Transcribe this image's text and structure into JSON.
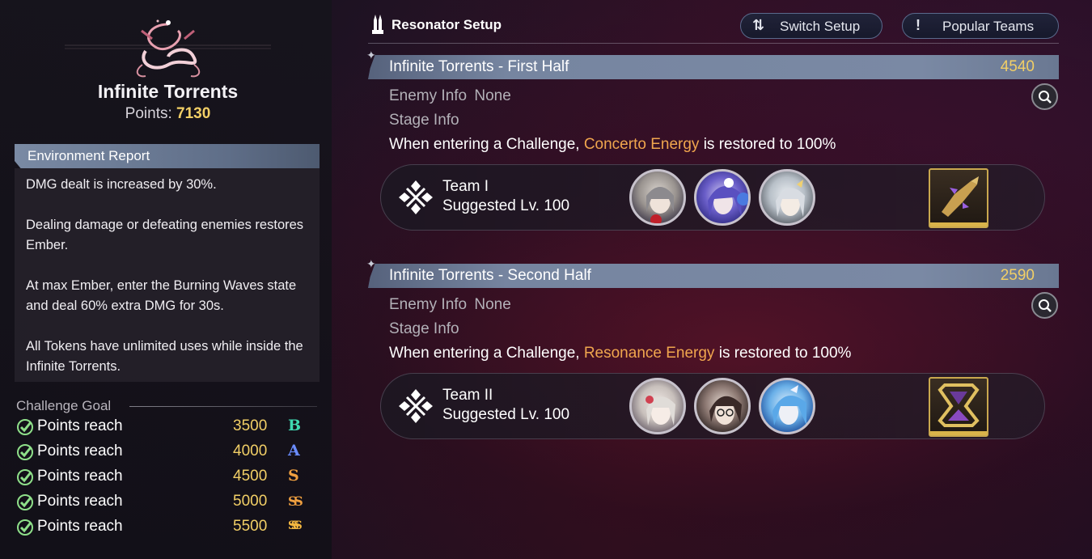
{
  "left": {
    "title": "Infinite Torrents",
    "points_label": "Points:",
    "points_value": "7130",
    "env_header": "Environment Report",
    "env_paragraphs": [
      "DMG dealt is increased by 30%.",
      "Dealing damage or defeating enemies restores Ember.",
      "At max Ember, enter the Burning Waves state and deal 60% extra DMG for 30s.",
      "All Tokens have unlimited uses while inside the Infinite Torrents."
    ],
    "goal_title": "Challenge Goal",
    "goals": [
      {
        "label": "Points reach",
        "value": "3500",
        "rank": "B",
        "color": "#3fd8b0"
      },
      {
        "label": "Points reach",
        "value": "4000",
        "rank": "A",
        "color": "#6a8cff"
      },
      {
        "label": "Points reach",
        "value": "4500",
        "rank": "S",
        "color": "#f0a040"
      },
      {
        "label": "Points reach",
        "value": "5000",
        "rank": "SS",
        "color": "#f0a040"
      },
      {
        "label": "Points reach",
        "value": "5500",
        "rank": "SSS",
        "color": "#f5b840"
      }
    ]
  },
  "header": {
    "title": "Resonator Setup",
    "switch_label": "Switch Setup",
    "popular_label": "Popular Teams"
  },
  "halves": [
    {
      "name": "Infinite Torrents - First Half",
      "score": "4540",
      "enemy_label": "Enemy Info",
      "enemy_value": "None",
      "stage_label": "Stage Info",
      "desc_pre": "When entering a Challenge,",
      "desc_hl": "Concerto Energy",
      "desc_post": "is restored to 100%",
      "team_name": "Team I",
      "team_level": "Suggested Lv. 100"
    },
    {
      "name": "Infinite Torrents - Second Half",
      "score": "2590",
      "enemy_label": "Enemy Info",
      "enemy_value": "None",
      "stage_label": "Stage Info",
      "desc_pre": "When entering a Challenge,",
      "desc_hl": "Resonance Energy",
      "desc_post": "is restored to 100%",
      "team_name": "Team II",
      "team_level": "Suggested Lv. 100"
    }
  ],
  "colors": {
    "gold": "#f2cf66",
    "highlight": "#f0a64e",
    "header_bar": "#7685a0"
  }
}
